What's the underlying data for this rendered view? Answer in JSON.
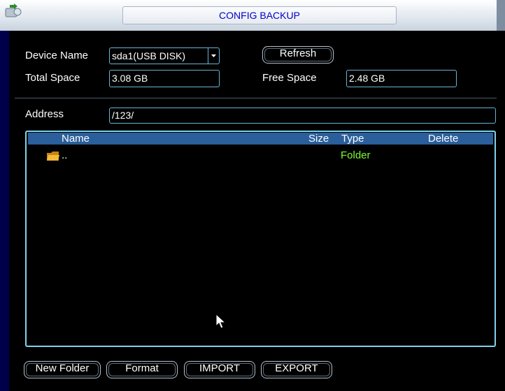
{
  "window": {
    "title": "CONFIG BACKUP"
  },
  "device": {
    "name_label": "Device Name",
    "name_value": "sda1(USB DISK)",
    "refresh_label": "Refresh",
    "total_label": "Total Space",
    "total_value": "3.08 GB",
    "free_label": "Free Space",
    "free_value": "2.48 GB"
  },
  "address": {
    "label": "Address",
    "value": "/123/"
  },
  "filelist": {
    "columns": {
      "name": "Name",
      "size": "Size",
      "type": "Type",
      "delete": "Delete"
    },
    "rows": [
      {
        "name": "..",
        "size": "",
        "type": "Folder",
        "icon": "folder-icon"
      }
    ]
  },
  "buttons": {
    "new_folder": "New Folder",
    "format": "Format",
    "import": "IMPORT",
    "export": "EXPORT"
  },
  "colors": {
    "accent": "#0000cc",
    "folder_type": "#7cff2a",
    "header_bar": "#2a5f9b",
    "field_border": "#69b3d6"
  }
}
